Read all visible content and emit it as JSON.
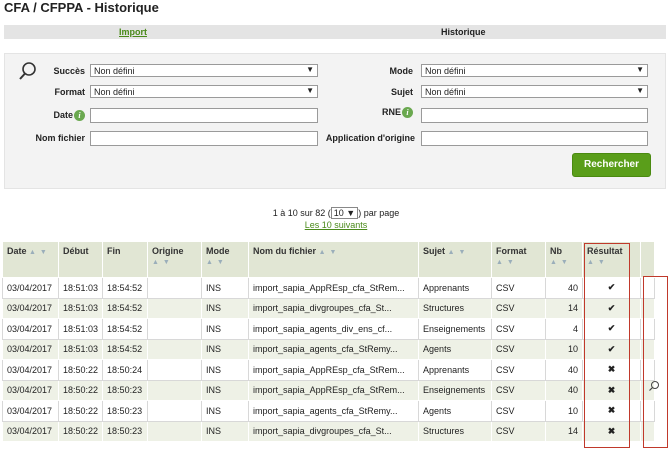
{
  "page": {
    "title": "CFA / CFPPA - Historique"
  },
  "tabs": {
    "import": "Import",
    "historique": "Historique"
  },
  "filters": {
    "succes_label": "Succès",
    "succes_value": "Non défini",
    "format_label": "Format",
    "format_value": "Non défini",
    "date_label": "Date",
    "nomfichier_label": "Nom fichier",
    "mode_label": "Mode",
    "mode_value": "Non défini",
    "sujet_label": "Sujet",
    "sujet_value": "Non défini",
    "rne_label": "RNE",
    "application_label": "Application d'origine",
    "search_button": "Rechercher",
    "info_glyph": "i"
  },
  "pager": {
    "range": "1 à 10 sur 82",
    "per_page_value": "10",
    "per_page_suffix": "par page",
    "next_link": "Les 10 suivants"
  },
  "table": {
    "headers": {
      "date": "Date",
      "debut": "Début",
      "fin": "Fin",
      "origine": "Origine",
      "mode": "Mode",
      "nom": "Nom du fichier",
      "sujet": "Sujet",
      "format": "Format",
      "nb": "Nb",
      "resultat": "Résultat"
    },
    "rows": [
      {
        "date": "03/04/2017",
        "debut": "18:51:03",
        "fin": "18:54:52",
        "origine": "",
        "mode": "INS",
        "nom": "import_sapia_AppREsp_cfa_StRem...",
        "sujet": "Apprenants",
        "format": "CSV",
        "nb": "40",
        "result": "success"
      },
      {
        "date": "03/04/2017",
        "debut": "18:51:03",
        "fin": "18:54:52",
        "origine": "",
        "mode": "INS",
        "nom": "import_sapia_divgroupes_cfa_St...",
        "sujet": "Structures",
        "format": "CSV",
        "nb": "14",
        "result": "success"
      },
      {
        "date": "03/04/2017",
        "debut": "18:51:03",
        "fin": "18:54:52",
        "origine": "",
        "mode": "INS",
        "nom": "import_sapia_agents_div_ens_cf...",
        "sujet": "Enseignements",
        "format": "CSV",
        "nb": "4",
        "result": "success"
      },
      {
        "date": "03/04/2017",
        "debut": "18:51:03",
        "fin": "18:54:52",
        "origine": "",
        "mode": "INS",
        "nom": "import_sapia_agents_cfa_StRemy...",
        "sujet": "Agents",
        "format": "CSV",
        "nb": "10",
        "result": "success"
      },
      {
        "date": "03/04/2017",
        "debut": "18:50:22",
        "fin": "18:50:24",
        "origine": "",
        "mode": "INS",
        "nom": "import_sapia_AppREsp_cfa_StRem...",
        "sujet": "Apprenants",
        "format": "CSV",
        "nb": "40",
        "result": "error"
      },
      {
        "date": "03/04/2017",
        "debut": "18:50:22",
        "fin": "18:50:23",
        "origine": "",
        "mode": "INS",
        "nom": "import_sapia_AppREsp_cfa_StRem...",
        "sujet": "Enseignements",
        "format": "CSV",
        "nb": "40",
        "result": "error"
      },
      {
        "date": "03/04/2017",
        "debut": "18:50:22",
        "fin": "18:50:23",
        "origine": "",
        "mode": "INS",
        "nom": "import_sapia_agents_cfa_StRemy...",
        "sujet": "Agents",
        "format": "CSV",
        "nb": "10",
        "result": "error"
      },
      {
        "date": "03/04/2017",
        "debut": "18:50:22",
        "fin": "18:50:23",
        "origine": "",
        "mode": "INS",
        "nom": "import_sapia_divgroupes_cfa_St...",
        "sujet": "Structures",
        "format": "CSV",
        "nb": "14",
        "result": "error"
      }
    ],
    "result_glyphs": {
      "success": "✔",
      "error": "✖"
    },
    "sort_glyph": "▲ ▼"
  },
  "colors": {
    "accent_green": "#5a9e1a",
    "success": "#6aa84f",
    "error": "#d9532a",
    "header_bg": "#e1e6d4",
    "row_alt_bg": "#eef1e6",
    "highlight": "#c0392b"
  },
  "icons": {
    "filter_search": "magnifier-icon",
    "info": "info-icon",
    "row_action": "magnifier-icon"
  }
}
